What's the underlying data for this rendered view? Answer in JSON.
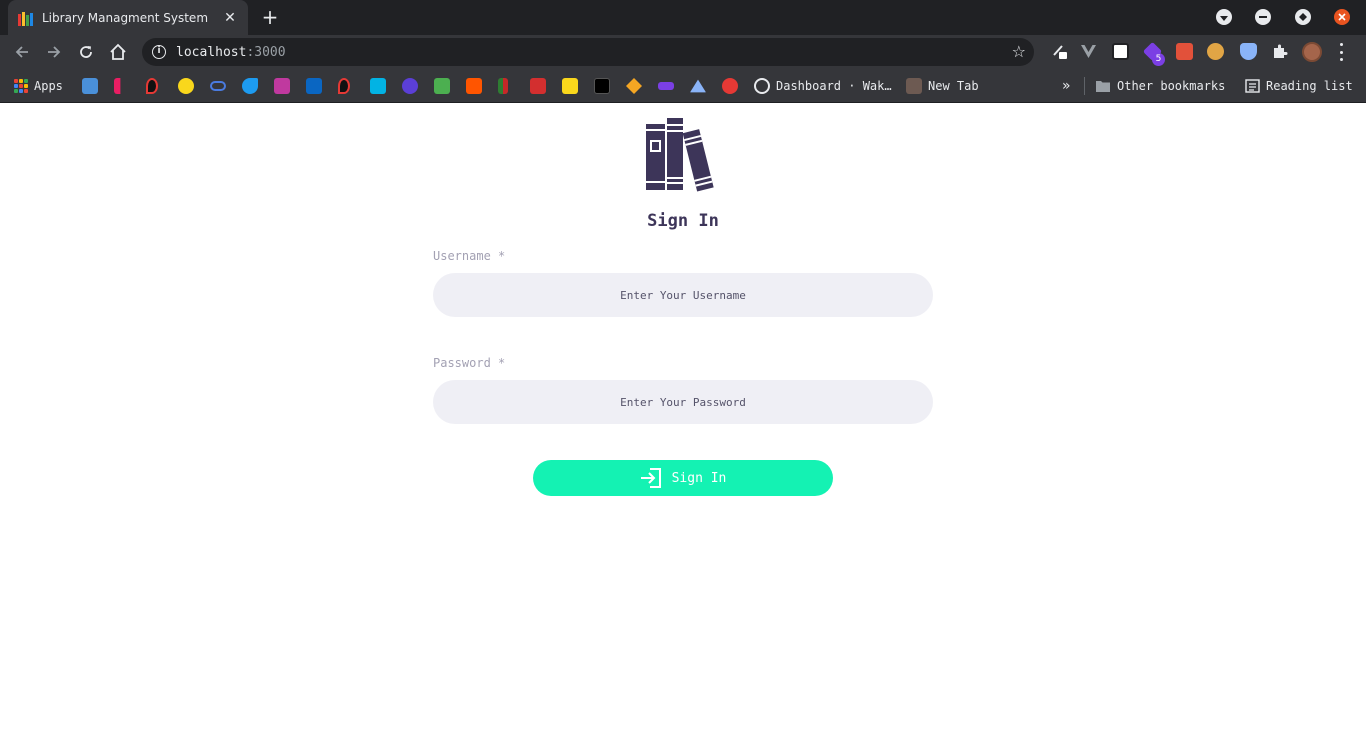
{
  "browser": {
    "tab_title": "Library Managment System",
    "tab_close": "✕",
    "new_tab": "+",
    "url_host": "localhost",
    "url_port": ":3000",
    "extension_badge": "5",
    "bookmarks": {
      "apps": "Apps",
      "dashboard": "Dashboard · Wak…",
      "new_tab": "New Tab",
      "overflow": "»",
      "other": "Other bookmarks",
      "reading_list": "Reading list"
    }
  },
  "page": {
    "title": "Sign In",
    "username": {
      "label": "Username",
      "required_mark": "*",
      "placeholder": "Enter Your Username"
    },
    "password": {
      "label": "Password",
      "required_mark": "*",
      "placeholder": "Enter Your Password"
    },
    "submit_label": "Sign In"
  },
  "colors": {
    "brand_dark": "#3d3559",
    "accent": "#14f2b3",
    "input_bg": "#efeff5",
    "label": "#a3a1b3"
  }
}
